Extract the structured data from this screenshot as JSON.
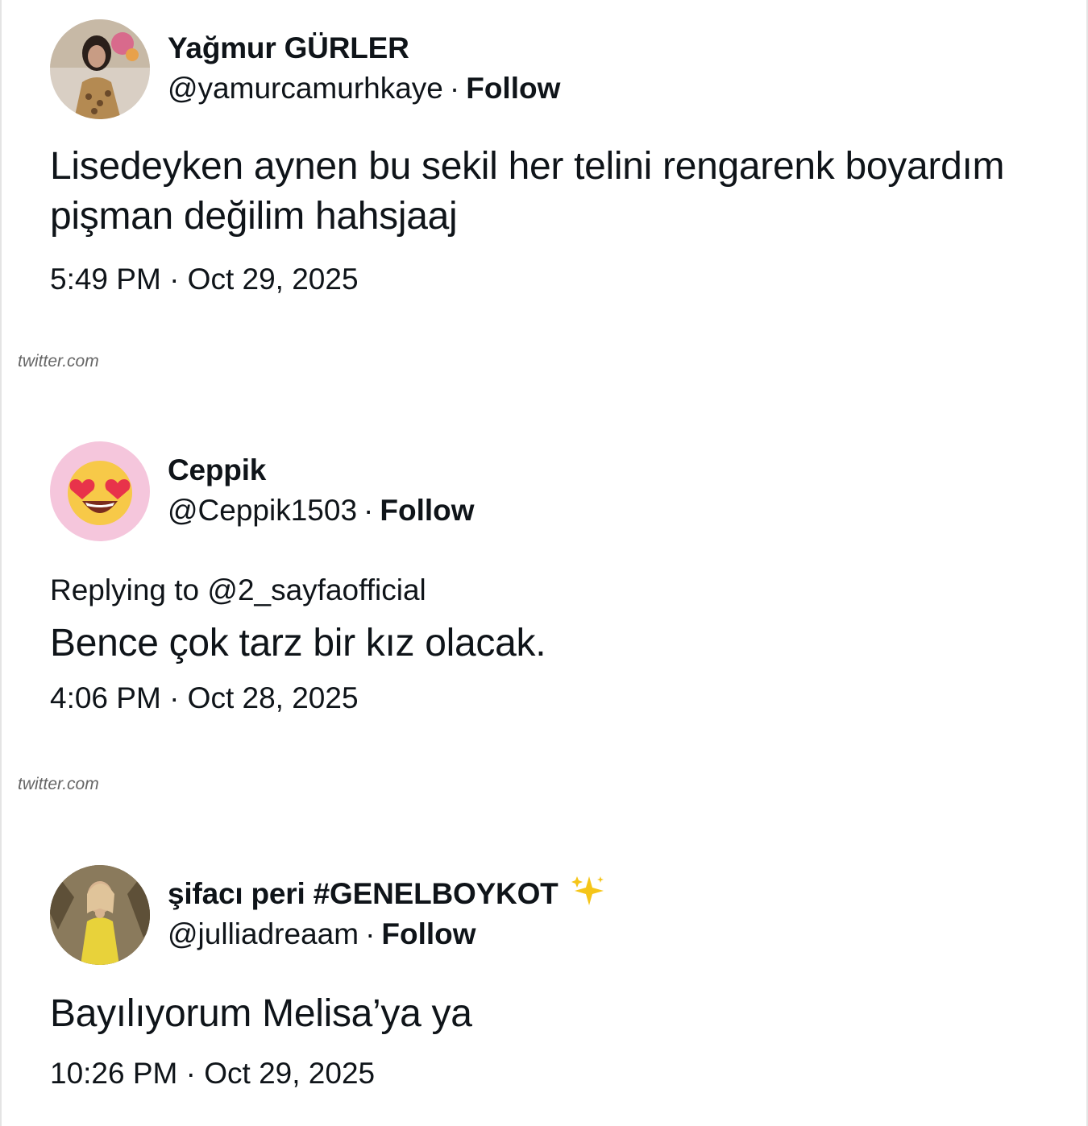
{
  "tweets": [
    {
      "display_name": "Yağmur GÜRLER",
      "handle": "@yamurcamurhkaye",
      "separator": "·",
      "follow_label": "Follow",
      "text_line1": "Lisedeyken aynen bu sekil her telini rengarenk boyardım",
      "text_line2": "pişman değilim hahsjaaj",
      "timestamp": "5:49 PM · Oct 29, 2025",
      "source": "twitter.com",
      "avatar": "photo-avatar"
    },
    {
      "display_name": "Ceppik",
      "handle": "@Ceppik1503",
      "separator": "·",
      "follow_label": "Follow",
      "reply_to": "Replying to @2_sayfaofficial",
      "text": "Bence çok tarz bir kız olacak.",
      "timestamp": "4:06 PM · Oct 28, 2025",
      "source": "twitter.com",
      "avatar": "heart-eyes-emoji-avatar"
    },
    {
      "display_name": "şifacı peri #GENELBOYKOT",
      "name_emoji": "sparkles-icon",
      "handle": "@julliadreaam",
      "separator": "·",
      "follow_label": "Follow",
      "text": "Bayılıyorum Melisa’ya ya",
      "timestamp": "10:26 PM · Oct 29, 2025",
      "avatar": "photo-avatar"
    }
  ],
  "colors": {
    "text": "#0f1419",
    "source": "#666666",
    "avatar_pink_bg": "#f5c6dc",
    "emoji_yellow": "#f7c948"
  }
}
